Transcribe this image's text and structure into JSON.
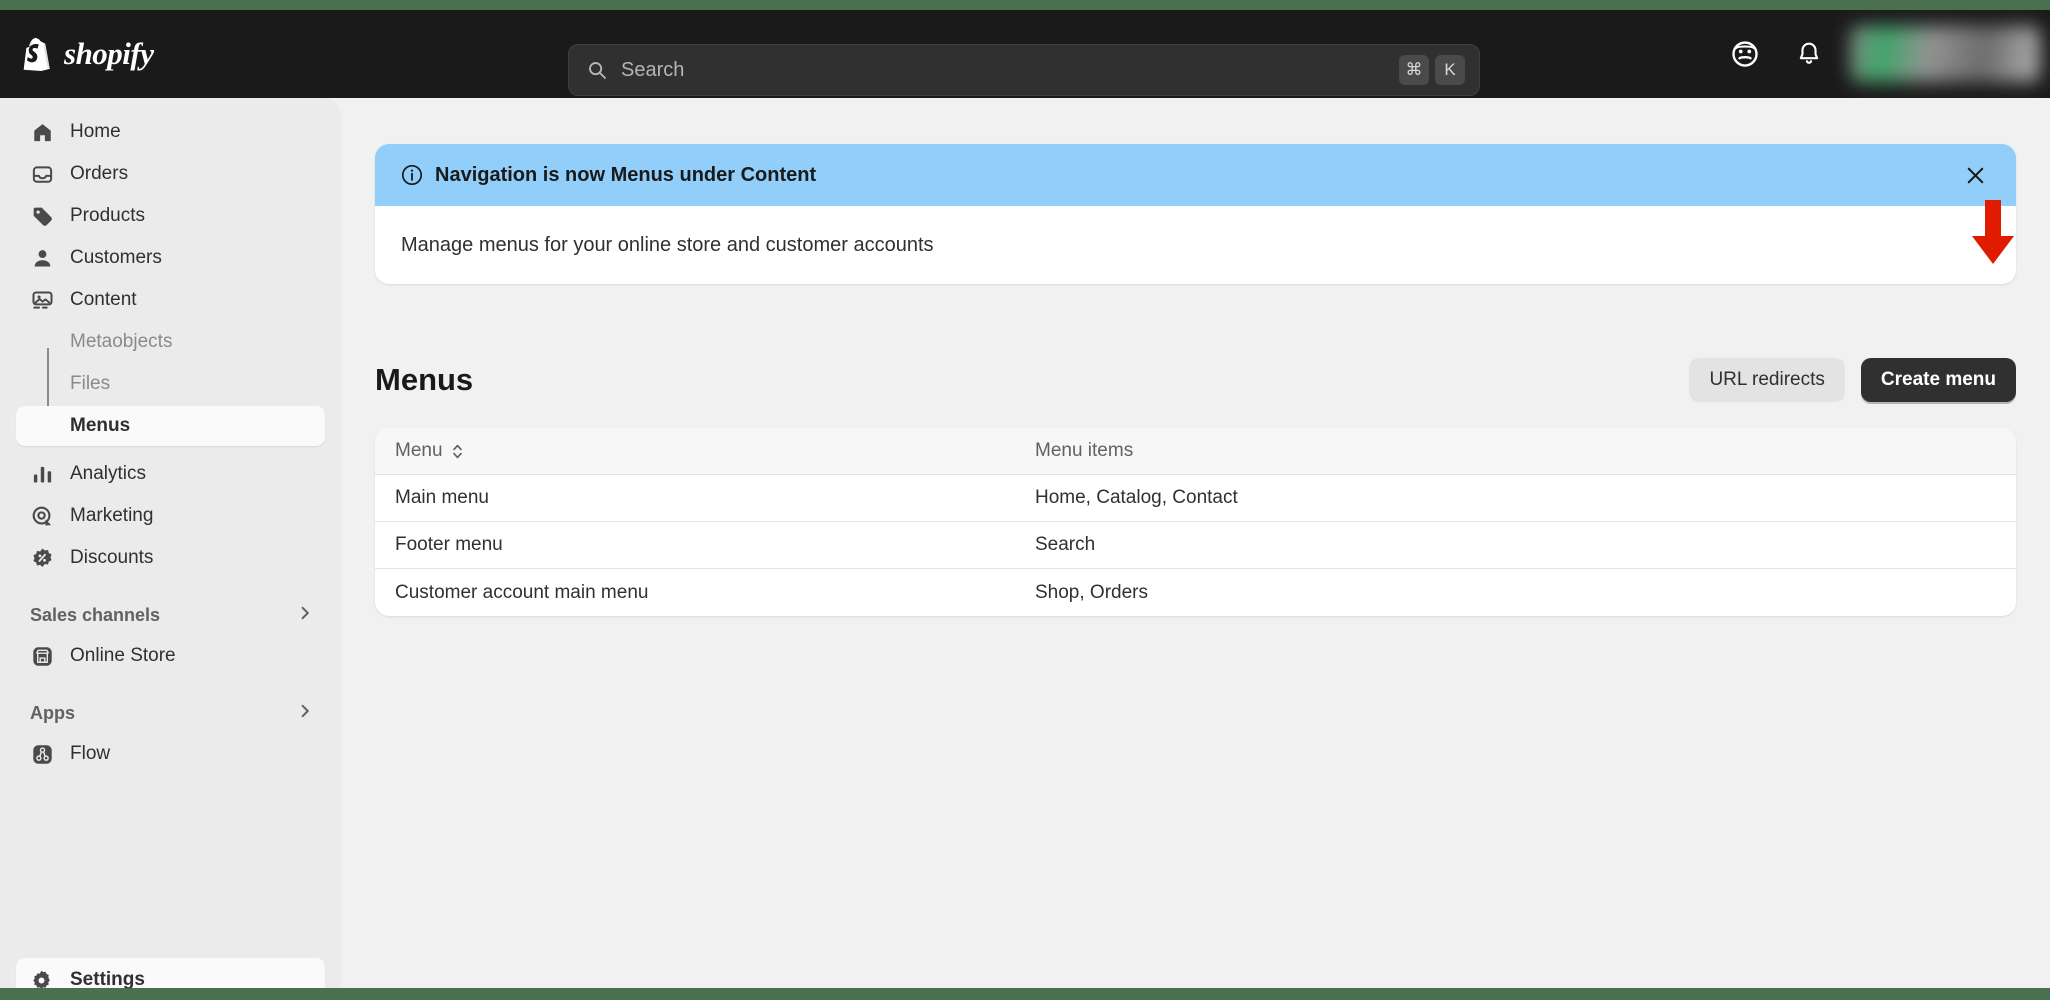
{
  "topbar": {
    "brand": "shopify",
    "brand_icon": "shopify-bag-icon",
    "search": {
      "placeholder": "Search",
      "icon": "search-icon",
      "shortcut_modifier": "⌘",
      "shortcut_key": "K"
    },
    "actions": [
      {
        "name": "avatar-face-icon",
        "icon": "face-icon"
      },
      {
        "name": "notifications-bell-icon",
        "icon": "bell-icon"
      }
    ],
    "store_chip": {
      "blurred": true,
      "label": ""
    }
  },
  "sidebar": {
    "items": [
      {
        "label": "Home",
        "icon": "home-icon",
        "selected": false
      },
      {
        "label": "Orders",
        "icon": "orders-inbox-icon",
        "selected": false
      },
      {
        "label": "Products",
        "icon": "products-tag-icon",
        "selected": false
      },
      {
        "label": "Customers",
        "icon": "customers-person-icon",
        "selected": false
      },
      {
        "label": "Content",
        "icon": "content-image-icon",
        "selected": false
      }
    ],
    "content_children": [
      {
        "label": "Metaobjects",
        "selected": false
      },
      {
        "label": "Files",
        "selected": false
      },
      {
        "label": "Menus",
        "selected": true
      }
    ],
    "items_after": [
      {
        "label": "Analytics",
        "icon": "analytics-bars-icon",
        "selected": false
      },
      {
        "label": "Marketing",
        "icon": "marketing-target-icon",
        "selected": false
      },
      {
        "label": "Discounts",
        "icon": "discounts-badge-icon",
        "selected": false
      }
    ],
    "sections": [
      {
        "title": "Sales channels",
        "chevron": "chevron-right-icon",
        "items": [
          {
            "label": "Online Store",
            "icon": "online-store-icon"
          }
        ]
      },
      {
        "title": "Apps",
        "chevron": "chevron-right-icon",
        "items": [
          {
            "label": "Flow",
            "icon": "flow-icon"
          }
        ]
      }
    ],
    "settings": {
      "label": "Settings",
      "icon": "gear-icon"
    }
  },
  "banner": {
    "icon": "info-circle-icon",
    "title": "Navigation is now Menus under Content",
    "body": "Manage menus for your online store and customer accounts",
    "close_icon": "close-icon",
    "accent_color": "#91cffa"
  },
  "page": {
    "title": "Menus",
    "secondary_button": "URL redirects",
    "primary_button": "Create menu"
  },
  "table": {
    "columns": [
      {
        "label": "Menu",
        "sortable": true,
        "sort_icon": "sort-caret-icon"
      },
      {
        "label": "Menu items",
        "sortable": false
      }
    ],
    "rows": [
      {
        "menu": "Main menu",
        "items": "Home, Catalog, Contact"
      },
      {
        "menu": "Footer menu",
        "items": "Search"
      },
      {
        "menu": "Customer account main menu",
        "items": "Shop, Orders"
      }
    ]
  },
  "annotation": {
    "arrow": {
      "name": "red-arrow-annotation",
      "color": "#e01b00",
      "points_to": "Create menu"
    }
  },
  "colors": {
    "frame_green": "#4a7050",
    "topbar": "#1a1a1a",
    "sidebar": "#ebebeb",
    "canvas": "#f1f1f1",
    "primary_button": "#303030"
  }
}
